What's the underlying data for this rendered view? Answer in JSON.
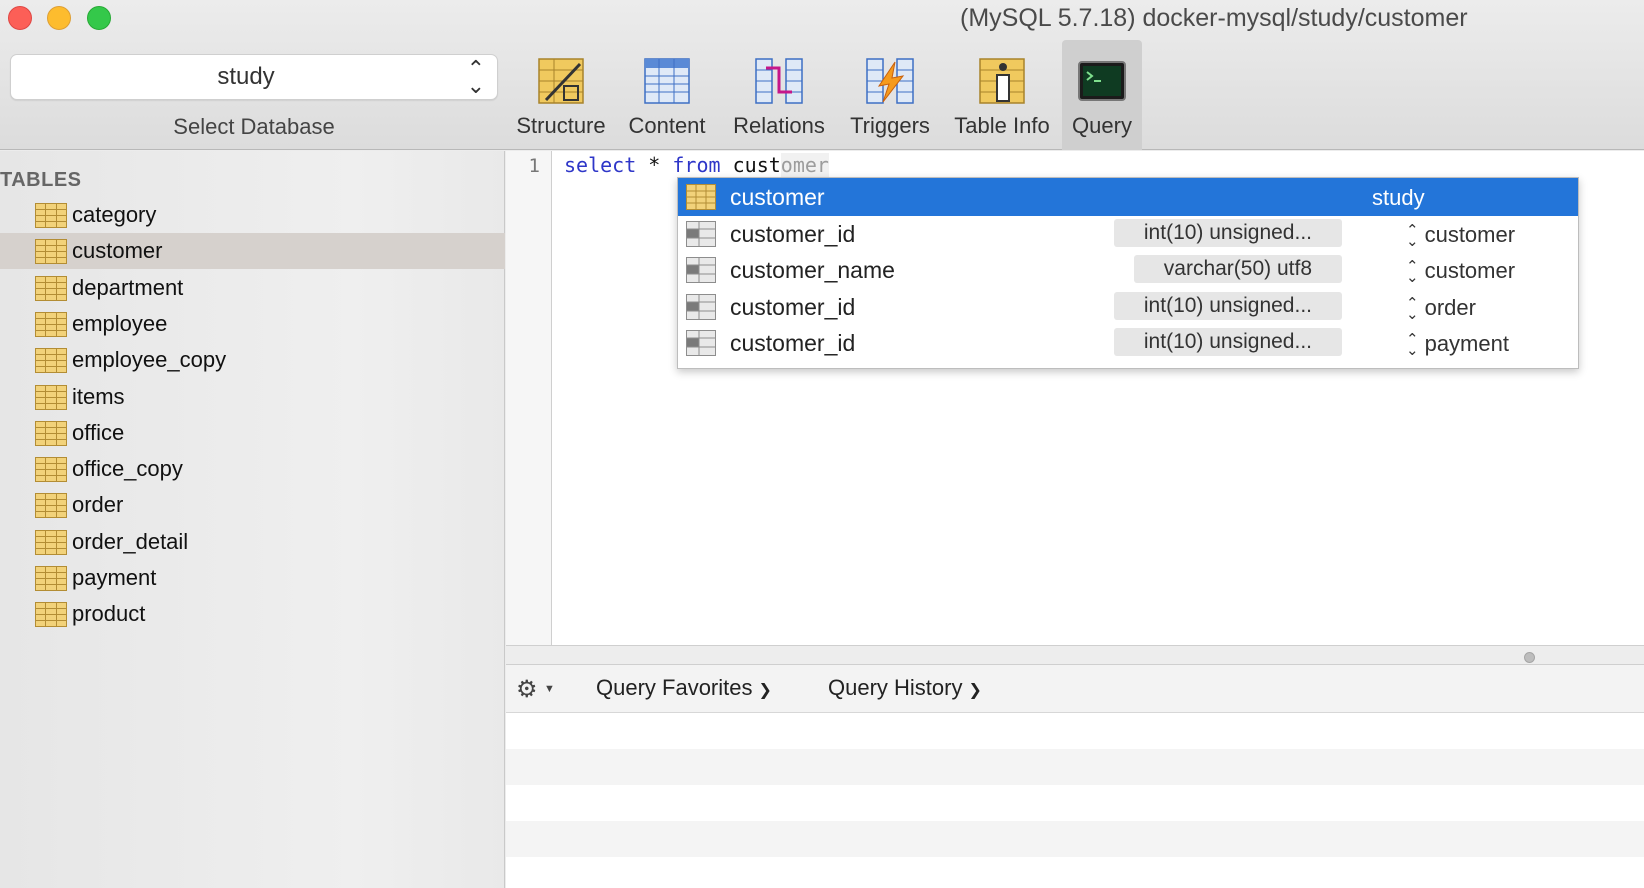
{
  "window": {
    "title": "(MySQL 5.7.18) docker-mysql/study/customer"
  },
  "database_selector": {
    "value": "study",
    "caption": "Select Database"
  },
  "toolbar": {
    "buttons": [
      {
        "label": "Structure",
        "icon": "structure-icon"
      },
      {
        "label": "Content",
        "icon": "content-icon"
      },
      {
        "label": "Relations",
        "icon": "relations-icon"
      },
      {
        "label": "Triggers",
        "icon": "triggers-icon"
      },
      {
        "label": "Table Info",
        "icon": "table-info-icon"
      },
      {
        "label": "Query",
        "icon": "query-icon",
        "active": true
      }
    ]
  },
  "sidebar": {
    "heading": "TABLES",
    "tables": [
      "category",
      "customer",
      "department",
      "employee",
      "employee_copy",
      "items",
      "office",
      "office_copy",
      "order",
      "order_detail",
      "payment",
      "product"
    ],
    "selected": "customer"
  },
  "editor": {
    "line_number": "1",
    "kw_select": "select",
    "star": "*",
    "kw_from": "from",
    "typed": "cust",
    "completion_suffix": "omer"
  },
  "autocomplete": {
    "items": [
      {
        "name": "customer",
        "type": "",
        "context": "study",
        "kind": "table",
        "selected": true
      },
      {
        "name": "customer_id",
        "type": "int(10) unsigned...",
        "context": "customer",
        "kind": "column"
      },
      {
        "name": "customer_name",
        "type": "varchar(50) utf8",
        "context": "customer",
        "kind": "column"
      },
      {
        "name": "customer_id",
        "type": "int(10) unsigned...",
        "context": "order",
        "kind": "column"
      },
      {
        "name": "customer_id",
        "type": "int(10) unsigned...",
        "context": "payment",
        "kind": "column"
      }
    ]
  },
  "bottom": {
    "query_favorites": "Query Favorites",
    "query_history": "Query History"
  },
  "colors": {
    "selection_blue": "#2375d9",
    "keyword_blue": "#2e36c8",
    "table_icon_yellow": "#f2d27a"
  }
}
